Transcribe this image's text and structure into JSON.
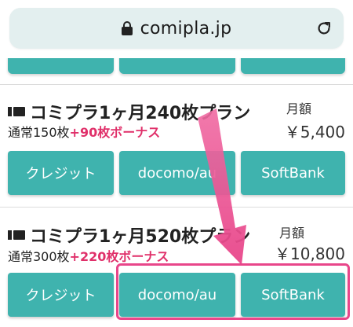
{
  "browser": {
    "url": "comipla.jp",
    "lock_icon": "lock-icon",
    "reload_icon": "reload-icon"
  },
  "plans": [
    {
      "title": "コミプラ1ヶ月240枚プラン",
      "normal": "通常150枚",
      "bonus": "+90枚ボーナス",
      "price_label": "月額",
      "price": "￥5,400",
      "buttons": [
        "クレジット",
        "docomo/au",
        "SoftBank"
      ]
    },
    {
      "title": "コミプラ1ヶ月520枚プラン",
      "normal": "通常300枚",
      "bonus": "+220枚ボーナス",
      "price_label": "月額",
      "price": "￥10,800",
      "buttons": [
        "クレジット",
        "docomo/au",
        "SoftBank"
      ]
    }
  ],
  "colors": {
    "button": "#3fb3ae",
    "bonus": "#e0306a",
    "annotation": "#e8468a"
  }
}
